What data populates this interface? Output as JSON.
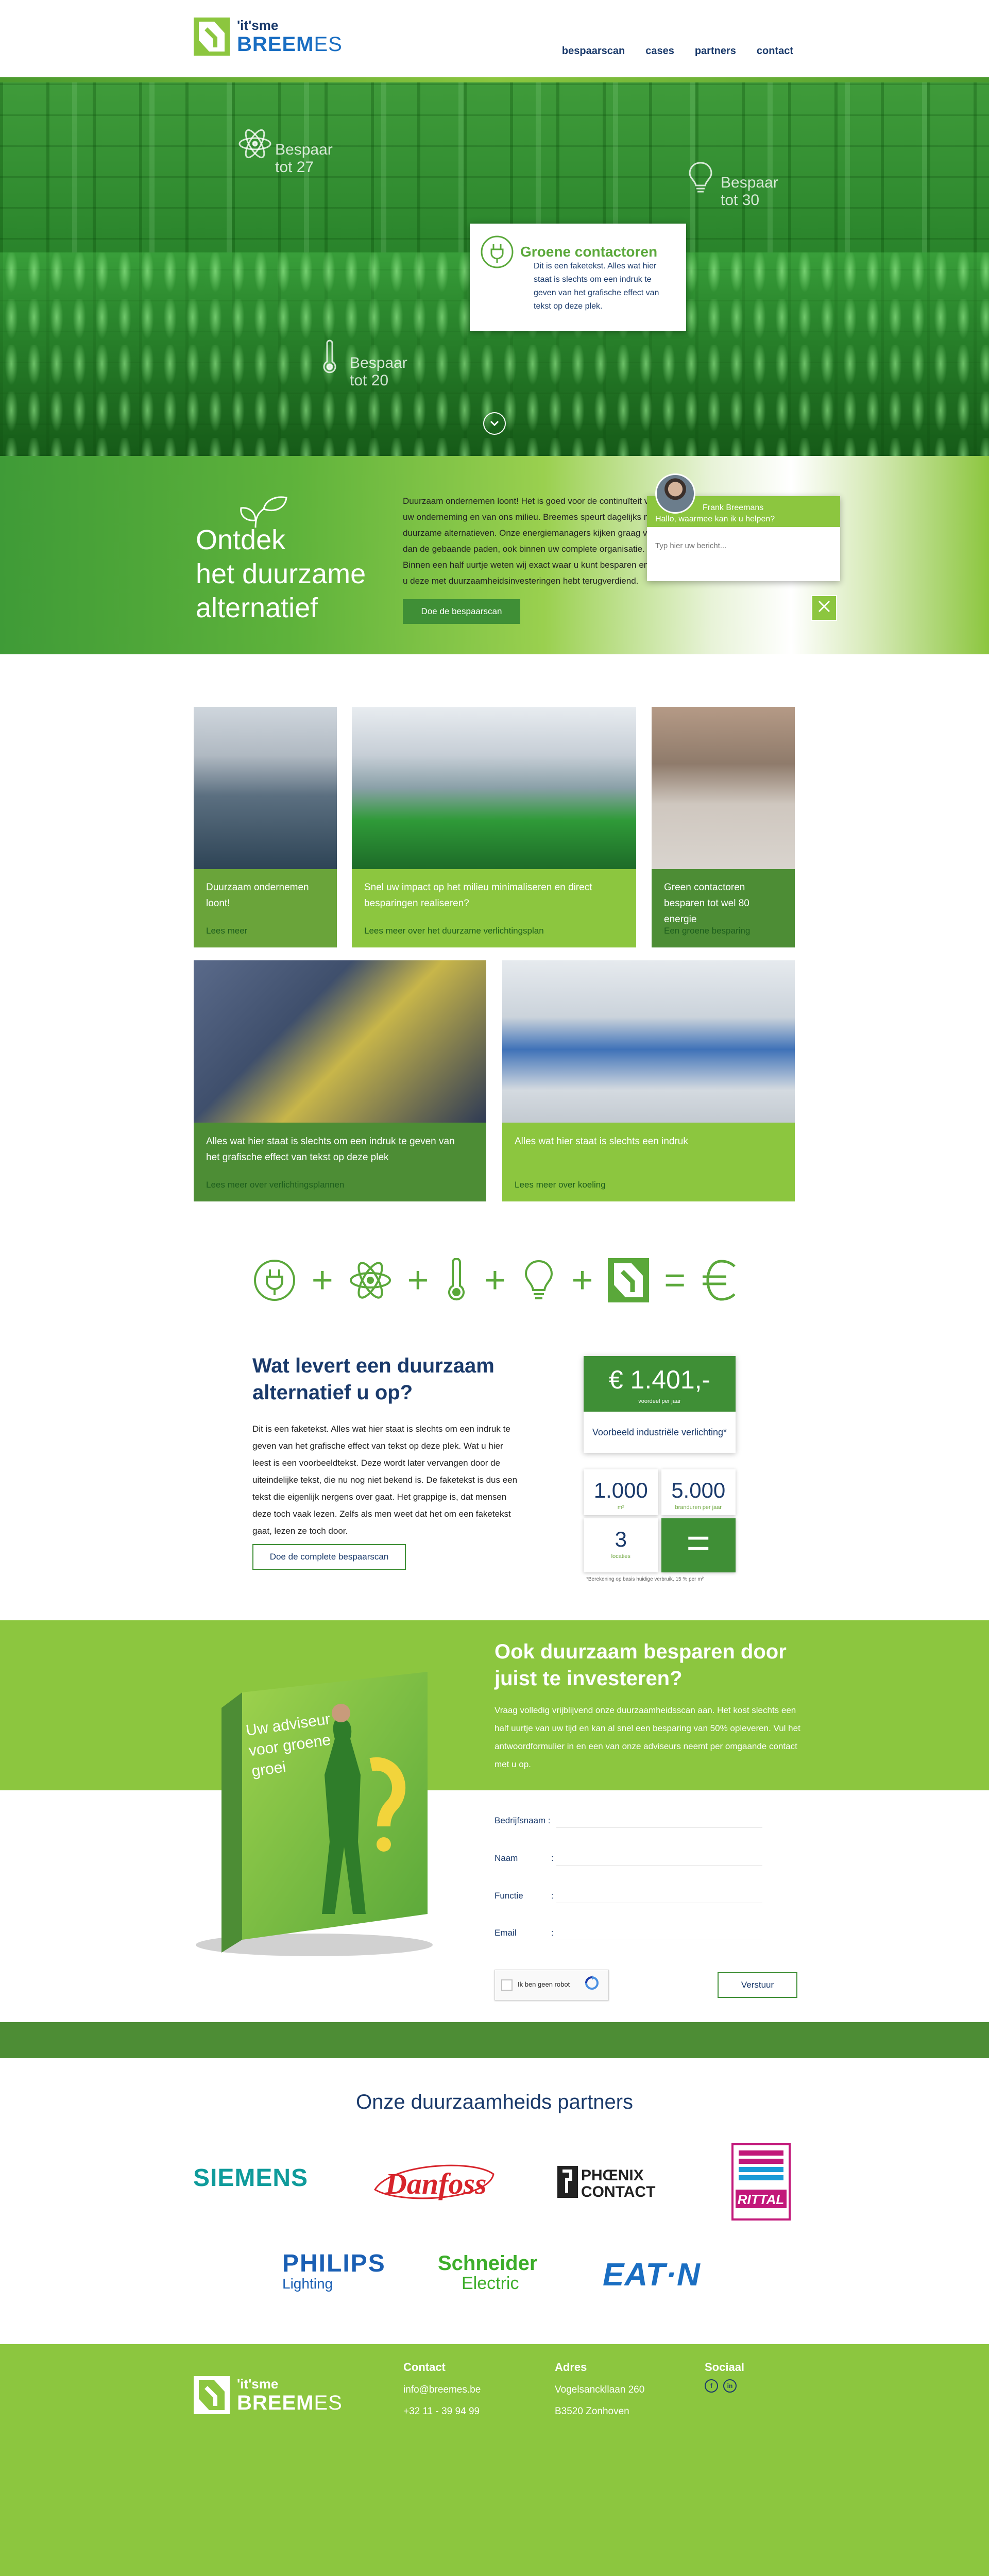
{
  "header": {
    "logo_its": "'it'sme",
    "logo_brand": "BREEM",
    "logo_brand_suffix": "ES",
    "nav": [
      "bespaarscan",
      "cases",
      "partners",
      "contact"
    ]
  },
  "hero": {
    "features": [
      {
        "icon": "atom-icon",
        "text": "Bespaar tot 27"
      },
      {
        "icon": "lightbulb-icon",
        "text": "Bespaar tot 30"
      },
      {
        "icon": "thermometer-icon",
        "text": "Bespaar tot 20"
      }
    ],
    "popup": {
      "icon": "plug-icon",
      "title": "Groene contactoren",
      "text": "Dit is een faketekst. Alles wat hier staat is slechts om een indruk te geven van het grafische effect van tekst op deze plek."
    },
    "scroll_icon": "chevron-down-icon"
  },
  "discover": {
    "heading_lines": [
      "Ontdek",
      "het duurzame",
      "alternatief"
    ],
    "body": "Duurzaam ondernemen loont! Het is goed voor de continuïteit van uw onderneming en van ons milieu. Breemes speurt dagelijks naar duurzame alternatieven. Onze energiemanagers kijken graag verder dan de gebaande paden, ook binnen uw complete organisatie. Binnen een half uurtje weten wij exact waar u kunt besparen en snel u deze met duurzaamheidsinvesteringen hebt terugverdiend.",
    "cta": "Doe de bespaarscan"
  },
  "chat": {
    "agent": "Frank Breemans",
    "greeting": "Hallo, waarmee kan ik u helpen?",
    "placeholder": "Typ hier uw bericht..."
  },
  "cases": [
    {
      "title": "Duurzaam ondernemen loont!",
      "link": "Lees meer"
    },
    {
      "title": "Snel uw impact op het milieu minimaliseren en direct besparingen realiseren?",
      "link": "Lees meer over het duurzame verlichtingsplan"
    },
    {
      "title": "Green contactoren besparen tot wel 80   energie",
      "link": "Een groene besparing"
    },
    {
      "title": "Alles wat hier staat is slechts om een indruk te geven van het grafische effect van tekst op deze plek",
      "link": "Lees meer over verlichtingsplannen"
    },
    {
      "title": "Alles wat hier staat is slechts een indruk",
      "link": "Lees meer over koeling"
    }
  ],
  "equation": {
    "icons": [
      "plug-icon",
      "atom-icon",
      "thermometer-icon",
      "lightbulb-icon",
      "breemes-logo-icon",
      "euro-icon"
    ],
    "ops": [
      "+",
      "+",
      "+",
      "+",
      "+",
      "="
    ]
  },
  "deliver": {
    "heading_lines": [
      "Wat levert een duurzaam",
      "alternatief u op?"
    ],
    "body": "Dit is een faketekst. Alles wat hier staat is slechts om een indruk te geven van het grafische effect van tekst op deze plek. Wat u hier leest is een voorbeeldtekst. Deze wordt later vervangen door de uiteindelijke tekst, die nu nog niet bekend is. De faketekst is dus een tekst die eigenlijk nergens over gaat. Het grappige is, dat mensen deze toch vaak lezen. Zelfs als men weet dat het om een faketekst gaat, lezen ze toch door.",
    "cta": "Doe de complete bespaarscan",
    "price": "€ 1.401,-",
    "price_sub": "voordeel per jaar",
    "example": "Voorbeeld industriële verlichting*",
    "cells": [
      {
        "value": "1.000",
        "sub": "m²"
      },
      {
        "value": "5.000",
        "sub": "branduren per jaar"
      },
      {
        "value": "3",
        "sub": "locaties"
      }
    ],
    "equals": "=",
    "note": "*Berekening op basis huidige verbruik, 15 % per m²"
  },
  "invest": {
    "book_text_lines": [
      "Uw adviseur",
      "voor groene",
      "groei"
    ],
    "heading_lines": [
      "Ook duurzaam besparen door",
      "juist te investeren?"
    ],
    "body": "Vraag volledig vrijblijvend onze duurzaamheidsscan aan. Het kost slechts een half uurtje van uw tijd en kan al snel een besparing van 50% opleveren. Vul het antwoordformulier in en een van onze adviseurs neemt per omgaande contact met u op.",
    "fields": [
      {
        "label": "Bedrijfsnaam :"
      },
      {
        "label": "Naam",
        "sep": ":"
      },
      {
        "label": "Functie",
        "sep": ":"
      },
      {
        "label": "Email",
        "sep": ":"
      }
    ],
    "captcha": "Ik ben geen robot",
    "submit": "Verstuur"
  },
  "partners": {
    "heading": "Onze duurzaamheids partners",
    "logos": {
      "siemens": "SIEMENS",
      "danfoss": "Danfoss",
      "phoenix_1": "PHŒNIX",
      "phoenix_2": "CONTACT",
      "rittal": "RITTAL",
      "philips_1": "PHILIPS",
      "philips_2": "Lighting",
      "schneider_1": "Schneider",
      "schneider_2": "Electric",
      "eaton": "EAT·N"
    }
  },
  "footer": {
    "logo_its": "'it'sme",
    "logo_brand": "BREEM",
    "logo_brand_suffix": "ES",
    "contact_title": "Contact",
    "email": "info@breemes.be",
    "phone": "+32 11 - 39 94 99",
    "address_title": "Adres",
    "street": "Vogelsanckllaan 260",
    "city": "B3520 Zonhoven",
    "social_title": "Sociaal",
    "social": [
      "f",
      "in"
    ]
  },
  "colors": {
    "green_dark": "#3f8f36",
    "green": "#8cc63f",
    "navy": "#1a3a6b",
    "blue": "#1a6ec2"
  }
}
